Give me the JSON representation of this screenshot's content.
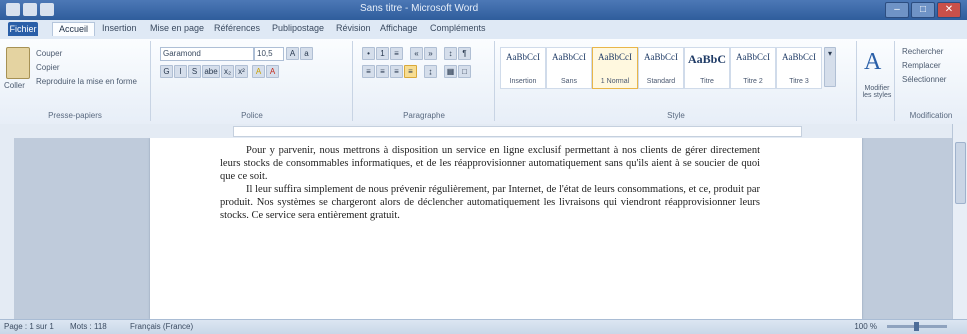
{
  "window": {
    "title": "Sans titre - Microsoft Word",
    "quick_access": [
      "save-icon",
      "undo-icon",
      "redo-icon"
    ],
    "controls": {
      "minimize": "–",
      "maximize": "□",
      "close": "✕"
    }
  },
  "tabs": [
    {
      "label": "Fichier"
    },
    {
      "label": "Accueil"
    },
    {
      "label": "Insertion"
    },
    {
      "label": "Mise en page"
    },
    {
      "label": "Références"
    },
    {
      "label": "Publipostage"
    },
    {
      "label": "Révision"
    },
    {
      "label": "Affichage"
    },
    {
      "label": "Compléments"
    }
  ],
  "ribbon": {
    "clipboard": {
      "paste": "Coller",
      "cut": "Couper",
      "copy": "Copier",
      "format_painter": "Reproduire la mise en forme",
      "label": "Presse-papiers"
    },
    "font": {
      "font_name": "Garamond",
      "font_size": "10,5",
      "label": "Police",
      "tools": [
        "G",
        "I",
        "S",
        "abe",
        "x₂",
        "x²",
        "A",
        "A"
      ]
    },
    "paragraph": {
      "label": "Paragraphe",
      "tools": [
        "≡",
        "≡",
        "≡",
        "≡",
        "¶"
      ]
    },
    "styles": {
      "label": "Style",
      "items": [
        {
          "sample": "AaBbCcI",
          "name": "Insertion"
        },
        {
          "sample": "AaBbCcI",
          "name": "Sans"
        },
        {
          "sample": "AaBbCcI",
          "name": "1 Normal"
        },
        {
          "sample": "AaBbCcI",
          "name": "Standard"
        },
        {
          "sample": "AaBbC",
          "name": "Titre"
        },
        {
          "sample": "AaBbCcI",
          "name": "Titre 2"
        },
        {
          "sample": "AaBbCcI",
          "name": "Titre 3"
        }
      ],
      "change_styles": "Modifier les styles"
    },
    "editing": {
      "label": "Modification",
      "find": "Rechercher",
      "replace": "Remplacer",
      "select": "Sélectionner"
    }
  },
  "document": {
    "paragraph_1": "Pour y parvenir, nous mettrons à disposition un service en ligne exclusif permettant à nos clients de gérer directement leurs stocks de consommables informatiques, et de les réapprovisionner automatiquement sans qu'ils aient à se soucier de quoi que ce soit.",
    "paragraph_2": "Il leur suffira simplement de nous prévenir régulièrement, par Internet, de l'état de leurs consommations, et ce, produit par produit. Nos systèmes se chargeront alors de déclencher automatiquement les livraisons qui viendront réapprovisionner leurs stocks. Ce service sera entièrement gratuit."
  },
  "status": {
    "page": "Page : 1 sur 1",
    "words": "Mots : 118",
    "language": "Français (France)",
    "zoom": "100 %"
  }
}
